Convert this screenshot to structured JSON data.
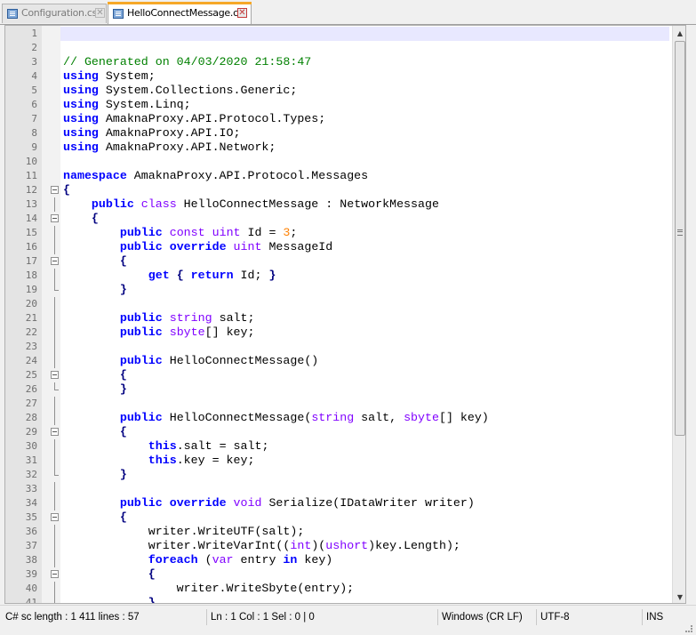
{
  "tabs": [
    {
      "label": "Configuration.cs",
      "active": false
    },
    {
      "label": "HelloConnectMessage.cs",
      "active": true
    }
  ],
  "editor": {
    "language": "C#",
    "current_line": 1,
    "lines": [
      {
        "n": "1",
        "tokens": []
      },
      {
        "n": "2",
        "tokens": []
      },
      {
        "n": "3",
        "tokens": [
          {
            "t": "// Generated on 04/03/2020 21:58:47",
            "c": "cm"
          }
        ]
      },
      {
        "n": "4",
        "tokens": [
          {
            "t": "using",
            "c": "kw"
          },
          {
            "t": " System;",
            "c": "pl"
          }
        ]
      },
      {
        "n": "5",
        "tokens": [
          {
            "t": "using",
            "c": "kw"
          },
          {
            "t": " System.Collections.Generic;",
            "c": "pl"
          }
        ]
      },
      {
        "n": "6",
        "tokens": [
          {
            "t": "using",
            "c": "kw"
          },
          {
            "t": " System.Linq;",
            "c": "pl"
          }
        ]
      },
      {
        "n": "7",
        "tokens": [
          {
            "t": "using",
            "c": "kw"
          },
          {
            "t": " AmaknaProxy.API.Protocol.Types;",
            "c": "pl"
          }
        ]
      },
      {
        "n": "8",
        "tokens": [
          {
            "t": "using",
            "c": "kw"
          },
          {
            "t": " AmaknaProxy.API.IO;",
            "c": "pl"
          }
        ]
      },
      {
        "n": "9",
        "tokens": [
          {
            "t": "using",
            "c": "kw"
          },
          {
            "t": " AmaknaProxy.API.Network;",
            "c": "pl"
          }
        ]
      },
      {
        "n": "10",
        "tokens": []
      },
      {
        "n": "11",
        "tokens": [
          {
            "t": "namespace",
            "c": "kw"
          },
          {
            "t": " AmaknaProxy.API.Protocol.Messages",
            "c": "pl"
          }
        ]
      },
      {
        "n": "12",
        "fold": "start",
        "tokens": [
          {
            "t": "{",
            "c": "op"
          }
        ]
      },
      {
        "n": "13",
        "fold": "in",
        "tokens": [
          {
            "t": "    ",
            "c": "pl"
          },
          {
            "t": "public",
            "c": "kw"
          },
          {
            "t": " ",
            "c": "pl"
          },
          {
            "t": "class",
            "c": "ty"
          },
          {
            "t": " HelloConnectMessage : NetworkMessage",
            "c": "pl"
          }
        ]
      },
      {
        "n": "14",
        "fold": "start",
        "tokens": [
          {
            "t": "    ",
            "c": "pl"
          },
          {
            "t": "{",
            "c": "op"
          }
        ]
      },
      {
        "n": "15",
        "fold": "in",
        "tokens": [
          {
            "t": "        ",
            "c": "pl"
          },
          {
            "t": "public",
            "c": "kw"
          },
          {
            "t": " ",
            "c": "pl"
          },
          {
            "t": "const",
            "c": "ty"
          },
          {
            "t": " ",
            "c": "pl"
          },
          {
            "t": "uint",
            "c": "ty"
          },
          {
            "t": " Id = ",
            "c": "pl"
          },
          {
            "t": "3",
            "c": "nu"
          },
          {
            "t": ";",
            "c": "pl"
          }
        ]
      },
      {
        "n": "16",
        "fold": "in",
        "tokens": [
          {
            "t": "        ",
            "c": "pl"
          },
          {
            "t": "public",
            "c": "kw"
          },
          {
            "t": " ",
            "c": "pl"
          },
          {
            "t": "override",
            "c": "kw"
          },
          {
            "t": " ",
            "c": "pl"
          },
          {
            "t": "uint",
            "c": "ty"
          },
          {
            "t": " MessageId",
            "c": "pl"
          }
        ]
      },
      {
        "n": "17",
        "fold": "start",
        "tokens": [
          {
            "t": "        ",
            "c": "pl"
          },
          {
            "t": "{",
            "c": "op"
          }
        ]
      },
      {
        "n": "18",
        "fold": "in",
        "tokens": [
          {
            "t": "            ",
            "c": "pl"
          },
          {
            "t": "get",
            "c": "kw"
          },
          {
            "t": " ",
            "c": "pl"
          },
          {
            "t": "{",
            "c": "op"
          },
          {
            "t": " ",
            "c": "pl"
          },
          {
            "t": "return",
            "c": "kw"
          },
          {
            "t": " Id; ",
            "c": "pl"
          },
          {
            "t": "}",
            "c": "op"
          }
        ]
      },
      {
        "n": "19",
        "fold": "end",
        "tokens": [
          {
            "t": "        ",
            "c": "pl"
          },
          {
            "t": "}",
            "c": "op"
          }
        ]
      },
      {
        "n": "20",
        "fold": "in",
        "tokens": []
      },
      {
        "n": "21",
        "fold": "in",
        "tokens": [
          {
            "t": "        ",
            "c": "pl"
          },
          {
            "t": "public",
            "c": "kw"
          },
          {
            "t": " ",
            "c": "pl"
          },
          {
            "t": "string",
            "c": "ty"
          },
          {
            "t": " salt;",
            "c": "pl"
          }
        ]
      },
      {
        "n": "22",
        "fold": "in",
        "tokens": [
          {
            "t": "        ",
            "c": "pl"
          },
          {
            "t": "public",
            "c": "kw"
          },
          {
            "t": " ",
            "c": "pl"
          },
          {
            "t": "sbyte",
            "c": "ty"
          },
          {
            "t": "[] key;",
            "c": "pl"
          }
        ]
      },
      {
        "n": "23",
        "fold": "in",
        "tokens": []
      },
      {
        "n": "24",
        "fold": "in",
        "tokens": [
          {
            "t": "        ",
            "c": "pl"
          },
          {
            "t": "public",
            "c": "kw"
          },
          {
            "t": " HelloConnectMessage()",
            "c": "pl"
          }
        ]
      },
      {
        "n": "25",
        "fold": "start",
        "tokens": [
          {
            "t": "        ",
            "c": "pl"
          },
          {
            "t": "{",
            "c": "op"
          }
        ]
      },
      {
        "n": "26",
        "fold": "end",
        "tokens": [
          {
            "t": "        ",
            "c": "pl"
          },
          {
            "t": "}",
            "c": "op"
          }
        ]
      },
      {
        "n": "27",
        "fold": "in",
        "tokens": []
      },
      {
        "n": "28",
        "fold": "in",
        "tokens": [
          {
            "t": "        ",
            "c": "pl"
          },
          {
            "t": "public",
            "c": "kw"
          },
          {
            "t": " HelloConnectMessage(",
            "c": "pl"
          },
          {
            "t": "string",
            "c": "ty"
          },
          {
            "t": " salt, ",
            "c": "pl"
          },
          {
            "t": "sbyte",
            "c": "ty"
          },
          {
            "t": "[] key)",
            "c": "pl"
          }
        ]
      },
      {
        "n": "29",
        "fold": "start",
        "tokens": [
          {
            "t": "        ",
            "c": "pl"
          },
          {
            "t": "{",
            "c": "op"
          }
        ]
      },
      {
        "n": "30",
        "fold": "in",
        "tokens": [
          {
            "t": "            ",
            "c": "pl"
          },
          {
            "t": "this",
            "c": "kw"
          },
          {
            "t": ".salt = salt;",
            "c": "pl"
          }
        ]
      },
      {
        "n": "31",
        "fold": "in",
        "tokens": [
          {
            "t": "            ",
            "c": "pl"
          },
          {
            "t": "this",
            "c": "kw"
          },
          {
            "t": ".key = key;",
            "c": "pl"
          }
        ]
      },
      {
        "n": "32",
        "fold": "end",
        "tokens": [
          {
            "t": "        ",
            "c": "pl"
          },
          {
            "t": "}",
            "c": "op"
          }
        ]
      },
      {
        "n": "33",
        "fold": "in",
        "tokens": []
      },
      {
        "n": "34",
        "fold": "in",
        "tokens": [
          {
            "t": "        ",
            "c": "pl"
          },
          {
            "t": "public",
            "c": "kw"
          },
          {
            "t": " ",
            "c": "pl"
          },
          {
            "t": "override",
            "c": "kw"
          },
          {
            "t": " ",
            "c": "pl"
          },
          {
            "t": "void",
            "c": "ty"
          },
          {
            "t": " Serialize(IDataWriter writer)",
            "c": "pl"
          }
        ]
      },
      {
        "n": "35",
        "fold": "start",
        "tokens": [
          {
            "t": "        ",
            "c": "pl"
          },
          {
            "t": "{",
            "c": "op"
          }
        ]
      },
      {
        "n": "36",
        "fold": "in",
        "tokens": [
          {
            "t": "            ",
            "c": "pl"
          },
          {
            "t": "writer.WriteUTF(salt);",
            "c": "pl"
          }
        ]
      },
      {
        "n": "37",
        "fold": "in",
        "tokens": [
          {
            "t": "            ",
            "c": "pl"
          },
          {
            "t": "writer.WriteVarInt((",
            "c": "pl"
          },
          {
            "t": "int",
            "c": "ty"
          },
          {
            "t": ")(",
            "c": "pl"
          },
          {
            "t": "ushort",
            "c": "ty"
          },
          {
            "t": ")key.Length);",
            "c": "pl"
          }
        ]
      },
      {
        "n": "38",
        "fold": "in",
        "tokens": [
          {
            "t": "            ",
            "c": "pl"
          },
          {
            "t": "foreach",
            "c": "kw"
          },
          {
            "t": " (",
            "c": "pl"
          },
          {
            "t": "var",
            "c": "ty"
          },
          {
            "t": " entry ",
            "c": "pl"
          },
          {
            "t": "in",
            "c": "kw"
          },
          {
            "t": " key)",
            "c": "pl"
          }
        ]
      },
      {
        "n": "39",
        "fold": "start",
        "tokens": [
          {
            "t": "            ",
            "c": "pl"
          },
          {
            "t": "{",
            "c": "op"
          }
        ]
      },
      {
        "n": "40",
        "fold": "in",
        "tokens": [
          {
            "t": "                ",
            "c": "pl"
          },
          {
            "t": "writer.WriteSbyte(entry);",
            "c": "pl"
          }
        ]
      },
      {
        "n": "41",
        "fold": "end",
        "tokens": [
          {
            "t": "            ",
            "c": "pl"
          },
          {
            "t": "}",
            "c": "op"
          }
        ]
      }
    ]
  },
  "status": {
    "file_info": "C# sc length : 1 411    lines : 57",
    "cursor": "Ln : 1    Col : 1    Sel : 0 | 0",
    "eol": "Windows (CR LF)",
    "encoding": "UTF-8",
    "mode": "INS"
  },
  "colors": {
    "keyword": "#0000ff",
    "type": "#8000ff",
    "comment": "#008000",
    "number": "#ff8000",
    "operator": "#000080",
    "current_line": "#e8e8ff",
    "active_tab_accent": "#f6a828"
  },
  "icons": {
    "tab_file": "file-icon",
    "tab_close": "close-icon",
    "fold_marker": "fold-minus-icon",
    "scroll_up": "scroll-up-arrow-icon",
    "scroll_down": "scroll-down-arrow-icon"
  }
}
